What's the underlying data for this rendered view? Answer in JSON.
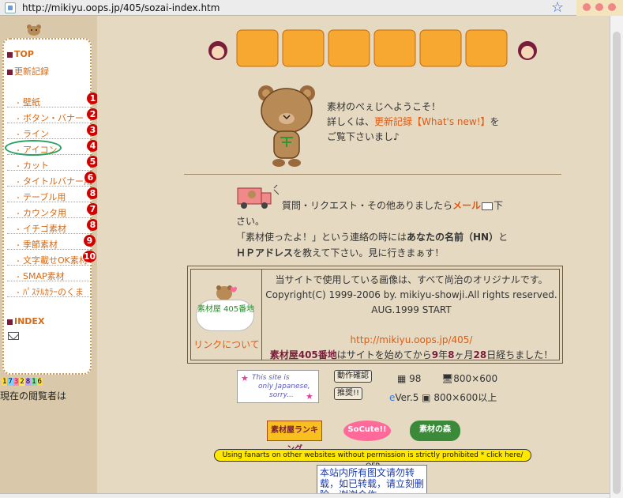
{
  "browser": {
    "url": "http://mikiyu.oops.jp/405/sozai-index.htm"
  },
  "sidebar": {
    "top_label": "TOP",
    "updates_label": "更新記録",
    "index_label": "INDEX",
    "items": [
      {
        "label": "壁紙",
        "badge": "1"
      },
      {
        "label": "ボタン・バナー",
        "badge": "2"
      },
      {
        "label": "ライン",
        "badge": "3"
      },
      {
        "label": "アイコン",
        "badge": "4"
      },
      {
        "label": "カット",
        "badge": "5"
      },
      {
        "label": "タイトルバナー用",
        "badge": "6"
      },
      {
        "label": "テーブル用",
        "badge": "8"
      },
      {
        "label": "カウンタ用",
        "badge": "7"
      },
      {
        "label": "イチゴ素材",
        "badge": "8"
      },
      {
        "label": "季節素材",
        "badge": "9"
      },
      {
        "label": "文字載せOK素材",
        "badge": "10"
      },
      {
        "label": "SMAP素材",
        "badge": ""
      },
      {
        "label": "ﾊﾟｽﾃﾙｶﾗｰのくま",
        "badge": ""
      }
    ],
    "counter_digits": [
      "1",
      "7",
      "3",
      "2",
      "8",
      "1",
      "6"
    ],
    "viewers_label": "現在の閲覧者は"
  },
  "main": {
    "welcome_line1": "素材のぺぇじへようこそ！",
    "welcome_line2_pre": "詳しくは、",
    "welcome_line2_link": "更新記録【What's new!】",
    "welcome_line2_post": "を",
    "welcome_line3": "ご覧下さいまし♪",
    "contact_line1_pre": "質問・リクエスト・その他ありましたら",
    "contact_mail_link": "メール",
    "contact_line1_post": "下",
    "contact_line2": "さい。",
    "contact_line3_pre": "「素材使ったよ！」という連絡の時には",
    "contact_line3_bold": "あなたの名前（HN）",
    "contact_line3_post": "と",
    "contact_line4_bold": "ＨＰアドレス",
    "contact_line4_post": "を教えて下さい。見に行きまぁす！",
    "link_banner_text": "素材屋 405番地",
    "link_about": "リンクについて",
    "info_line1": "当サイトで使用している画像は、すべて尚治のオリジナルです。",
    "info_line2": "Copyright(C) 1999-2006 by. mikiyu-showji.All rights reserved.",
    "info_line3": "AUG.1999 START",
    "info_url": "http://mikiyu.oops.jp/405/",
    "info_site_name": "素材屋405番地",
    "info_since_pre": "はサイトを始めてから",
    "info_years": "9",
    "info_years_unit": "年",
    "info_months": "8",
    "info_months_unit": "ヶ月",
    "info_days": "28",
    "info_days_unit": "日経ちました！",
    "jp_badge_text1": "This site is",
    "jp_badge_text2": "only Japanese,",
    "jp_badge_text3": "sorry...",
    "check_btn": "動作確認",
    "recommend_btn": "推奨!!",
    "os_version": "98",
    "resolution1": "800×600",
    "ie_version": "Ver.5",
    "resolution2": "800×600以上",
    "rank_btn1": "素材屋ランキング",
    "rank_btn2": "SoCute!!",
    "rank_btn3": "素材の森",
    "warning_bar": "Using fanarts on other websites without permission is strictly prohibited * click here/ OFP",
    "cn_notice": "本站内所有图文请勿转载，如已转载，请立刻删除，谢谢合作"
  },
  "colors": {
    "accent_orange": "#e05a10",
    "maroon": "#7a1d3a",
    "badge_red": "#d00000",
    "bg_tan": "#e6d9c2",
    "circle_green": "#2ba060"
  }
}
